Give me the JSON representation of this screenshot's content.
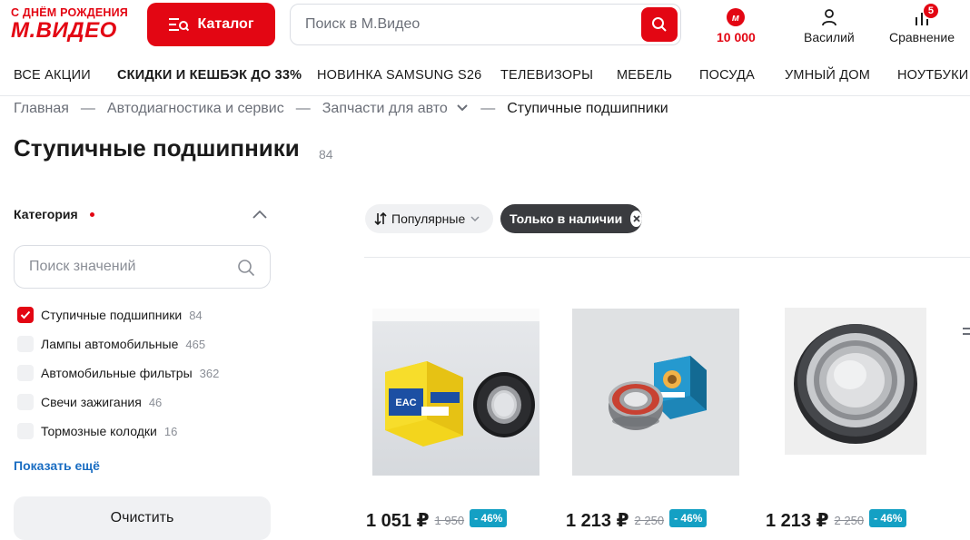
{
  "header": {
    "logo_top": "С ДНЁМ РОЖДЕНИЯ",
    "logo_main": "М.ВИДЕО",
    "catalog_label": "Каталог",
    "search_placeholder": "Поиск в М.Видео",
    "bonus": "10 000",
    "user": "Василий",
    "compare": "Сравнение",
    "compare_count": "5"
  },
  "nav": [
    {
      "label": "ВСЕ АКЦИИ",
      "bold": false
    },
    {
      "label": "СКИДКИ И КЕШБЭК ДО 33%",
      "bold": true
    },
    {
      "label": "НОВИНКА SAMSUNG S26",
      "bold": false
    },
    {
      "label": "ТЕЛЕВИЗОРЫ",
      "bold": false
    },
    {
      "label": "МЕБЕЛЬ",
      "bold": false
    },
    {
      "label": "ПОСУДА",
      "bold": false
    },
    {
      "label": "УМНЫЙ ДОМ",
      "bold": false
    },
    {
      "label": "НОУТБУКИ",
      "bold": false
    }
  ],
  "breadcrumb": {
    "items": [
      "Главная",
      "Автодиагностика и сервис",
      "Запчасти для авто"
    ],
    "current": "Ступичные подшипники",
    "separator": "—"
  },
  "page": {
    "title": "Ступичные подшипники",
    "count": "84"
  },
  "filter": {
    "title": "Категория",
    "search_placeholder": "Поиск значений",
    "items": [
      {
        "label": "Ступичные подшипники",
        "count": "84",
        "checked": true
      },
      {
        "label": "Лампы автомобильные",
        "count": "465",
        "checked": false
      },
      {
        "label": "Автомобильные фильтры",
        "count": "362",
        "checked": false
      },
      {
        "label": "Свечи зажигания",
        "count": "46",
        "checked": false
      },
      {
        "label": "Тормозные колодки",
        "count": "16",
        "checked": false
      }
    ],
    "show_more": "Показать ещё",
    "clear": "Очистить"
  },
  "chips": {
    "sort": "Популярные",
    "stock": "Только в наличии"
  },
  "products": [
    {
      "price": "1 051 ₽",
      "old_price": "1 950",
      "discount": "- 46%"
    },
    {
      "price": "1 213 ₽",
      "old_price": "2 250",
      "discount": "- 46%"
    },
    {
      "price": "1 213 ₽",
      "old_price": "2 250",
      "discount": "- 46%"
    }
  ],
  "colors": {
    "brand_red": "#e30613",
    "discount_blue": "#14a0c4",
    "link_blue": "#1a6dc2",
    "chip_dark": "#3a3b3f"
  }
}
